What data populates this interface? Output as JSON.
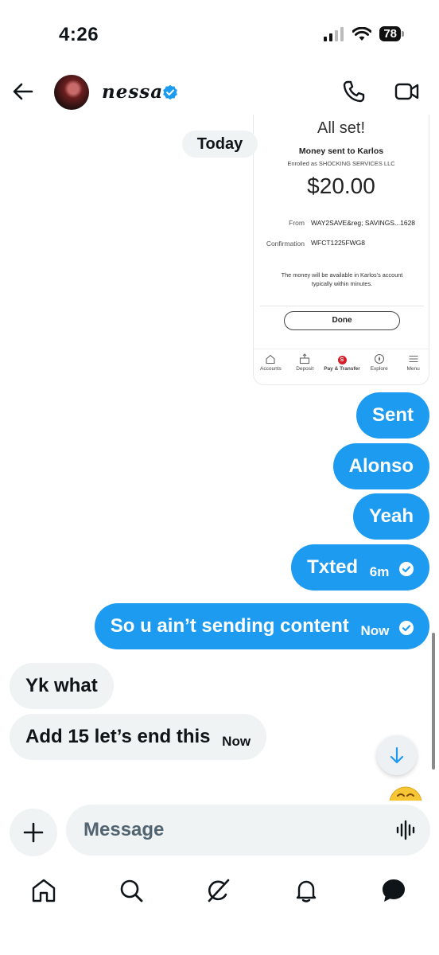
{
  "status": {
    "time": "4:26",
    "battery": "78"
  },
  "header": {
    "name": "nessa"
  },
  "date_chip": "Today",
  "shared_image": {
    "title": "All set!",
    "subtitle": "Money sent to Karlos",
    "enrolled": "Enrolled as SHOCKING SERVICES LLC",
    "amount": "$20.00",
    "from_label": "From",
    "from_value": "WAY2SAVE&reg; SAVINGS...1628",
    "confirmation_label": "Confirmation",
    "confirmation_value": "WFCT1225FWG8",
    "note": "The money will be available in Karlos's account typically within minutes.",
    "done_label": "Done",
    "nav": [
      "Accounts",
      "Deposit",
      "Pay & Transfer",
      "Explore",
      "Menu"
    ],
    "nav_badge": "S"
  },
  "messages": [
    {
      "text": "Sent",
      "direction": "out"
    },
    {
      "text": "Alonso",
      "direction": "out"
    },
    {
      "text": "Yeah",
      "direction": "out"
    },
    {
      "text": "Txted",
      "direction": "out",
      "time": "6m",
      "read": true
    },
    {
      "text": "So u ain’t sending content",
      "direction": "out",
      "time": "Now",
      "read": true
    },
    {
      "text": "Yk what",
      "direction": "in"
    },
    {
      "text": "Add 15 let’s end this",
      "direction": "in",
      "time": "Now"
    }
  ],
  "composer": {
    "placeholder": "Message"
  },
  "colors": {
    "accent": "#1d9bf0",
    "incoming_bubble": "#eff3f4",
    "text": "#0f1419",
    "muted": "#536471"
  },
  "icons": {
    "header": [
      "back-arrow-icon",
      "verified-badge-icon",
      "phone-icon",
      "video-camera-icon"
    ],
    "composer": [
      "plus-icon",
      "voice-waveform-icon"
    ],
    "bottom_nav": [
      "home-icon",
      "search-icon",
      "grok-icon",
      "notifications-bell-icon",
      "messages-icon"
    ]
  }
}
